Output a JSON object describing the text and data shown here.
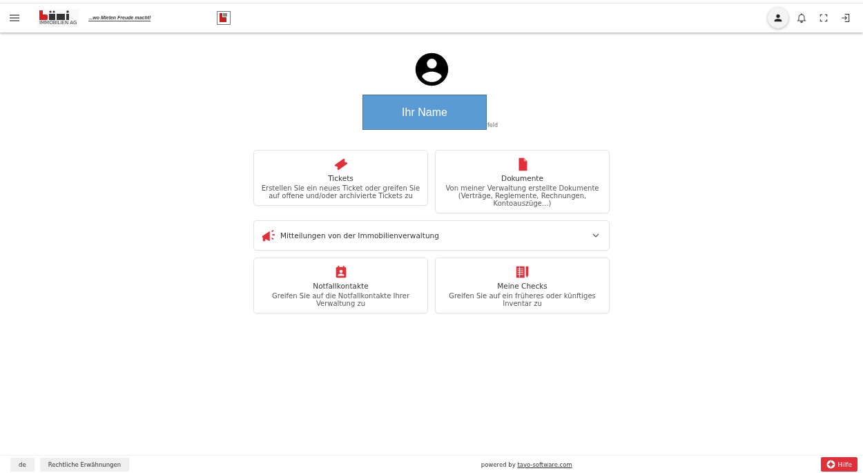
{
  "header": {
    "logo_caption": "IMMOBILIEN AG",
    "slogan": "...wo Mieten Freude macht!",
    "actions": [
      {
        "kind": "profile",
        "selected": true
      },
      {
        "kind": "bell",
        "selected": false
      },
      {
        "kind": "fullscreen",
        "selected": false
      },
      {
        "kind": "logout",
        "selected": false
      }
    ]
  },
  "profile": {
    "name_overlay": "Ihr Name",
    "address_fragment": "feld"
  },
  "tiles": [
    {
      "kind": "ticket",
      "title": "Tickets",
      "text": "Erstellen Sie ein neues Ticket oder greifen Sie auf offene und/oder archivierte Tickets zu"
    },
    {
      "kind": "document",
      "title": "Dokumente",
      "text": "Von meiner Verwaltung erstellte Dokumente (Verträge, Reglemente, Rechnungen, Kontoauszüge...)"
    }
  ],
  "announcements": {
    "title": "Mitteilungen von der Immobilienverwaltung",
    "expanded": false
  },
  "tiles_bottom": [
    {
      "kind": "contact",
      "title": "Notfallkontakte",
      "text": "Greifen Sie auf die Notfallkontakte Ihrer Verwaltung zu"
    },
    {
      "kind": "checklist",
      "title": "Meine Checks",
      "text": "Greifen Sie auf ein früheres oder künftiges Inventar zu"
    }
  ],
  "footer": {
    "language": "de",
    "legal": "Rechtliche Erwähnungen",
    "powered_prefix": "powered by",
    "powered_link": "tayo-software.com",
    "help": "Hilfe"
  }
}
